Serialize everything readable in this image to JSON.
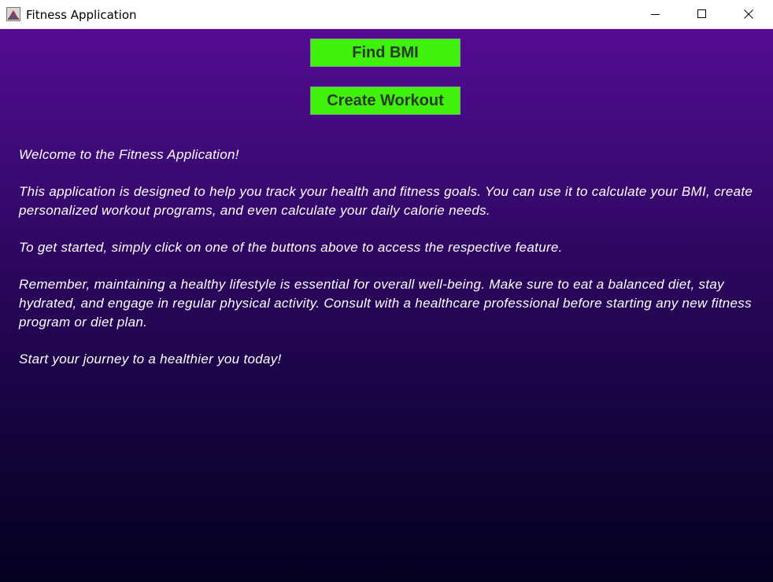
{
  "window": {
    "title": "Fitness Application"
  },
  "buttons": {
    "find_bmi": "Find BMI",
    "create_workout": "Create Workout"
  },
  "welcome": {
    "p1": "Welcome to the Fitness Application!",
    "p2": "This application is designed to help you track your health and fitness goals. You can use it to calculate your BMI, create personalized workout programs, and even calculate your daily calorie needs.",
    "p3": "To get started, simply click on one of the buttons above to access the respective feature.",
    "p4": "Remember, maintaining a healthy lifestyle is essential for overall well-being. Make sure to eat a balanced diet, stay hydrated, and engage in regular physical activity. Consult with a healthcare professional before starting any new fitness program or diet plan.",
    "p5": "Start your journey to a healthier you today!"
  },
  "colors": {
    "button_bg": "#3ff20d",
    "button_text": "#2a3a2a",
    "gradient_top": "#560b94",
    "gradient_bottom": "#040120",
    "text": "#ffffff"
  },
  "icons": {
    "app": "java-app-icon",
    "minimize": "minimize-icon",
    "maximize": "maximize-icon",
    "close": "close-icon"
  }
}
